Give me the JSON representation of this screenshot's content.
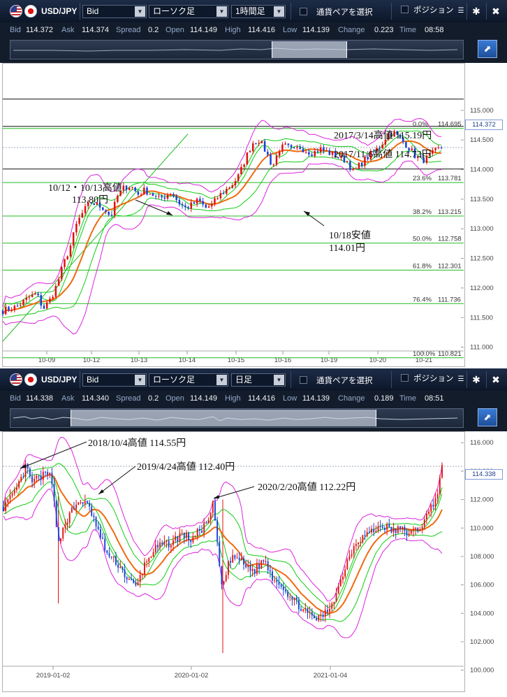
{
  "panels": [
    {
      "toolbar": {
        "symbol": "USD/JPY",
        "price_type": "Bid",
        "chart_type": "ローソク足",
        "timeframe": "1時間足",
        "pair_select_label": "通貨ペアを選択",
        "position_label": "ポジション"
      },
      "quote": {
        "bid_label": "Bid",
        "bid": "114.372",
        "ask_label": "Ask",
        "ask": "114.374",
        "spread_label": "Spread",
        "spread": "0.2",
        "open_label": "Open",
        "open": "114.149",
        "high_label": "High",
        "high": "114.416",
        "low_label": "Low",
        "low": "114.139",
        "change_label": "Change",
        "change": "0.223",
        "time_label": "Time",
        "time": "08:58"
      },
      "current_price": "114.372",
      "annotations": {
        "h2017_03": "2017/3/14高値 115.19円",
        "h2017_11": "2017/11/6高値 114.73円",
        "h1012_line1": "10/12・10/13高値",
        "h1012_line2": "113.80円",
        "l1018_line1": "10/18安値",
        "l1018_line2": "114.01円"
      },
      "fib_labels": [
        "0.0%",
        "23.6%",
        "38.2%",
        "50.0%",
        "61.8%",
        "76.4%",
        "100.0%"
      ],
      "fib_values": [
        "114.695",
        "113.781",
        "113.215",
        "112.758",
        "112.301",
        "111.736",
        "110.821"
      ]
    },
    {
      "toolbar": {
        "symbol": "USD/JPY",
        "price_type": "Bid",
        "chart_type": "ローソク足",
        "timeframe": "日足",
        "pair_select_label": "通貨ペアを選択",
        "position_label": "ポジション"
      },
      "quote": {
        "bid_label": "Bid",
        "bid": "114.338",
        "ask_label": "Ask",
        "ask": "114.340",
        "spread_label": "Spread",
        "spread": "0.2",
        "open_label": "Open",
        "open": "114.149",
        "high_label": "High",
        "high": "114.416",
        "low_label": "Low",
        "low": "114.139",
        "change_label": "Change",
        "change": "0.189",
        "time_label": "Time",
        "time": "08:51"
      },
      "current_price": "114.338",
      "annotations": {
        "h2018": "2018/10/4高値 114.55円",
        "h2019": "2019/4/24高値 112.40円",
        "h2020": "2020/2/20高値 112.22円"
      }
    }
  ],
  "colors": {
    "candle_up": "#e11010",
    "candle_down": "#1a3fd6",
    "ma_orange": "#f06a10",
    "band_green": "#11cc11",
    "band_magenta": "#dd22dd",
    "fib_line": "#22bb22"
  },
  "chart_data": [
    {
      "type": "candlestick",
      "title": "USD/JPY 1時間足",
      "x_tick_labels": [
        "10-09",
        "10-12",
        "10-13",
        "10-14",
        "10-15",
        "10-16",
        "10-19",
        "10-20",
        "10-21"
      ],
      "y_tick_labels": [
        "115.000",
        "114.500",
        "114.000",
        "113.500",
        "113.000",
        "112.500",
        "112.000",
        "111.500",
        "111.000"
      ],
      "ylim": [
        110.7,
        115.4
      ],
      "horizontal_levels": [
        115.19,
        114.73,
        114.01
      ],
      "fibonacci": [
        {
          "label": "0.0%",
          "value": 114.695
        },
        {
          "label": "23.6%",
          "value": 113.781
        },
        {
          "label": "38.2%",
          "value": 113.215
        },
        {
          "label": "50.0%",
          "value": 112.758
        },
        {
          "label": "61.8%",
          "value": 112.301
        },
        {
          "label": "76.4%",
          "value": 111.736
        },
        {
          "label": "100.0%",
          "value": 110.821
        }
      ],
      "close_path": [
        [
          0,
          111.62
        ],
        [
          2,
          111.68
        ],
        [
          4,
          111.85
        ],
        [
          5,
          111.9
        ],
        [
          6,
          111.65
        ],
        [
          7,
          111.8
        ],
        [
          8,
          112.05
        ],
        [
          9,
          112.4
        ],
        [
          10,
          112.7
        ],
        [
          11,
          113.1
        ],
        [
          12,
          113.3
        ],
        [
          13,
          113.45
        ],
        [
          14,
          113.4
        ],
        [
          15,
          113.35
        ],
        [
          16,
          113.2
        ],
        [
          17,
          113.55
        ],
        [
          18,
          113.7
        ],
        [
          19,
          113.72
        ],
        [
          20,
          113.58
        ],
        [
          21,
          113.65
        ],
        [
          22,
          113.6
        ],
        [
          23,
          113.5
        ],
        [
          24,
          113.55
        ],
        [
          25,
          113.62
        ],
        [
          26,
          113.45
        ],
        [
          27,
          113.35
        ],
        [
          28,
          113.4
        ],
        [
          29,
          113.48
        ],
        [
          30,
          113.35
        ],
        [
          31,
          113.4
        ],
        [
          32,
          113.55
        ],
        [
          33,
          113.65
        ],
        [
          34,
          113.75
        ],
        [
          35,
          113.9
        ],
        [
          36,
          114.2
        ],
        [
          37,
          114.45
        ],
        [
          38,
          114.5
        ],
        [
          39,
          114.3
        ],
        [
          40,
          114.05
        ],
        [
          41,
          114.35
        ],
        [
          42,
          114.4
        ],
        [
          43,
          114.3
        ],
        [
          44,
          114.38
        ],
        [
          45,
          114.32
        ],
        [
          46,
          114.28
        ],
        [
          47,
          114.35
        ],
        [
          48,
          114.3
        ],
        [
          49,
          114.25
        ],
        [
          50,
          114.2
        ],
        [
          51,
          114.15
        ],
        [
          52,
          113.95
        ],
        [
          53,
          114.1
        ],
        [
          54,
          114.2
        ],
        [
          55,
          114.3
        ],
        [
          56,
          114.4
        ],
        [
          57,
          114.6
        ],
        [
          58,
          114.62
        ],
        [
          59,
          114.5
        ],
        [
          60,
          114.4
        ],
        [
          61,
          114.25
        ],
        [
          62,
          114.15
        ],
        [
          63,
          114.2
        ],
        [
          64,
          114.3
        ],
        [
          65,
          114.37
        ]
      ]
    },
    {
      "type": "candlestick",
      "title": "USD/JPY 日足",
      "x_tick_labels": [
        "2019-01-02",
        "2020-01-02",
        "2021-01-04"
      ],
      "y_tick_labels": [
        "116.000",
        "114.000",
        "112.000",
        "110.000",
        "108.000",
        "106.000",
        "104.000",
        "102.000",
        "100.000"
      ],
      "ylim": [
        99.0,
        116.7
      ],
      "close_path": [
        [
          0,
          111.5
        ],
        [
          2,
          112.2
        ],
        [
          4,
          113.5
        ],
        [
          5,
          114.4
        ],
        [
          6,
          113.2
        ],
        [
          8,
          113.6
        ],
        [
          10,
          113.8
        ],
        [
          11,
          112.5
        ],
        [
          12,
          108.8
        ],
        [
          13,
          110.0
        ],
        [
          15,
          111.2
        ],
        [
          17,
          112.0
        ],
        [
          19,
          111.3
        ],
        [
          21,
          109.5
        ],
        [
          23,
          108.0
        ],
        [
          25,
          107.5
        ],
        [
          27,
          106.5
        ],
        [
          29,
          105.8
        ],
        [
          31,
          107.5
        ],
        [
          33,
          108.5
        ],
        [
          35,
          108.8
        ],
        [
          37,
          109.0
        ],
        [
          39,
          109.6
        ],
        [
          41,
          109.2
        ],
        [
          43,
          109.8
        ],
        [
          45,
          110.5
        ],
        [
          46,
          111.8
        ],
        [
          47,
          108.0
        ],
        [
          48,
          105.5
        ],
        [
          49,
          107.5
        ],
        [
          51,
          108.0
        ],
        [
          53,
          107.3
        ],
        [
          55,
          107.0
        ],
        [
          57,
          107.8
        ],
        [
          59,
          106.5
        ],
        [
          61,
          106.0
        ],
        [
          63,
          105.0
        ],
        [
          65,
          104.5
        ],
        [
          67,
          103.8
        ],
        [
          69,
          103.6
        ],
        [
          71,
          104.2
        ],
        [
          73,
          105.5
        ],
        [
          75,
          107.5
        ],
        [
          77,
          109.0
        ],
        [
          79,
          109.5
        ],
        [
          81,
          109.8
        ],
        [
          83,
          110.2
        ],
        [
          85,
          109.8
        ],
        [
          87,
          109.9
        ],
        [
          89,
          109.6
        ],
        [
          91,
          110.0
        ],
        [
          93,
          111.0
        ],
        [
          95,
          112.5
        ],
        [
          96,
          114.3
        ]
      ]
    }
  ]
}
